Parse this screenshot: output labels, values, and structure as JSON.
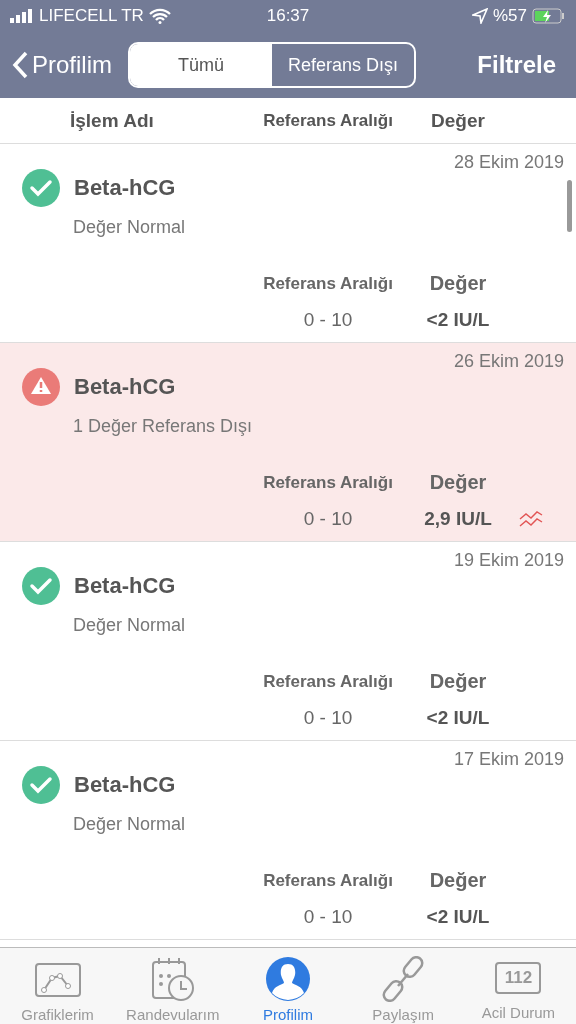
{
  "status_bar": {
    "carrier": "LIFECELL TR",
    "time": "16:37",
    "battery": "%57"
  },
  "nav": {
    "back": "Profilim",
    "segments": [
      {
        "label": "Tümü",
        "selected": true
      },
      {
        "label": "Referans Dışı",
        "selected": false
      }
    ],
    "action": "Filtrele"
  },
  "columns": [
    "İşlem Adı",
    "Referans Aralığı",
    "Değer"
  ],
  "results": [
    {
      "kind": "normal",
      "date": "28 Ekim 2019",
      "name": "Beta-hCG",
      "status": "Değer Normal",
      "range_label": "Referans Aralığı",
      "value_label": "Değer",
      "range": "0 - 10",
      "value": "<2 IU/L"
    },
    {
      "kind": "alert",
      "date": "26 Ekim 2019",
      "name": "Beta-hCG",
      "status": "1 Değer Referans Dışı",
      "range_label": "Referans Aralığı",
      "value_label": "Değer",
      "range": "0 - 10",
      "value": "2,9 IU/L"
    },
    {
      "kind": "normal",
      "date": "19 Ekim 2019",
      "name": "Beta-hCG",
      "status": "Değer Normal",
      "range_label": "Referans Aralığı",
      "value_label": "Değer",
      "range": "0 - 10",
      "value": "<2 IU/L"
    },
    {
      "kind": "normal",
      "date": "17 Ekim 2019",
      "name": "Beta-hCG",
      "status": "Değer Normal",
      "range_label": "Referans Aralığı",
      "value_label": "Değer",
      "range": "0 - 10",
      "value": "<2 IU/L"
    }
  ],
  "tab_bar": [
    {
      "kind": "chart",
      "label": "Grafiklerim",
      "selected": false
    },
    {
      "kind": "calendar",
      "label": "Randevularım",
      "selected": false
    },
    {
      "kind": "profile",
      "label": "Profilim",
      "selected": true
    },
    {
      "kind": "link",
      "label": "Paylaşım",
      "selected": false
    },
    {
      "kind": "emergency",
      "label": "Acil Durum",
      "badge": "112",
      "selected": false
    }
  ]
}
